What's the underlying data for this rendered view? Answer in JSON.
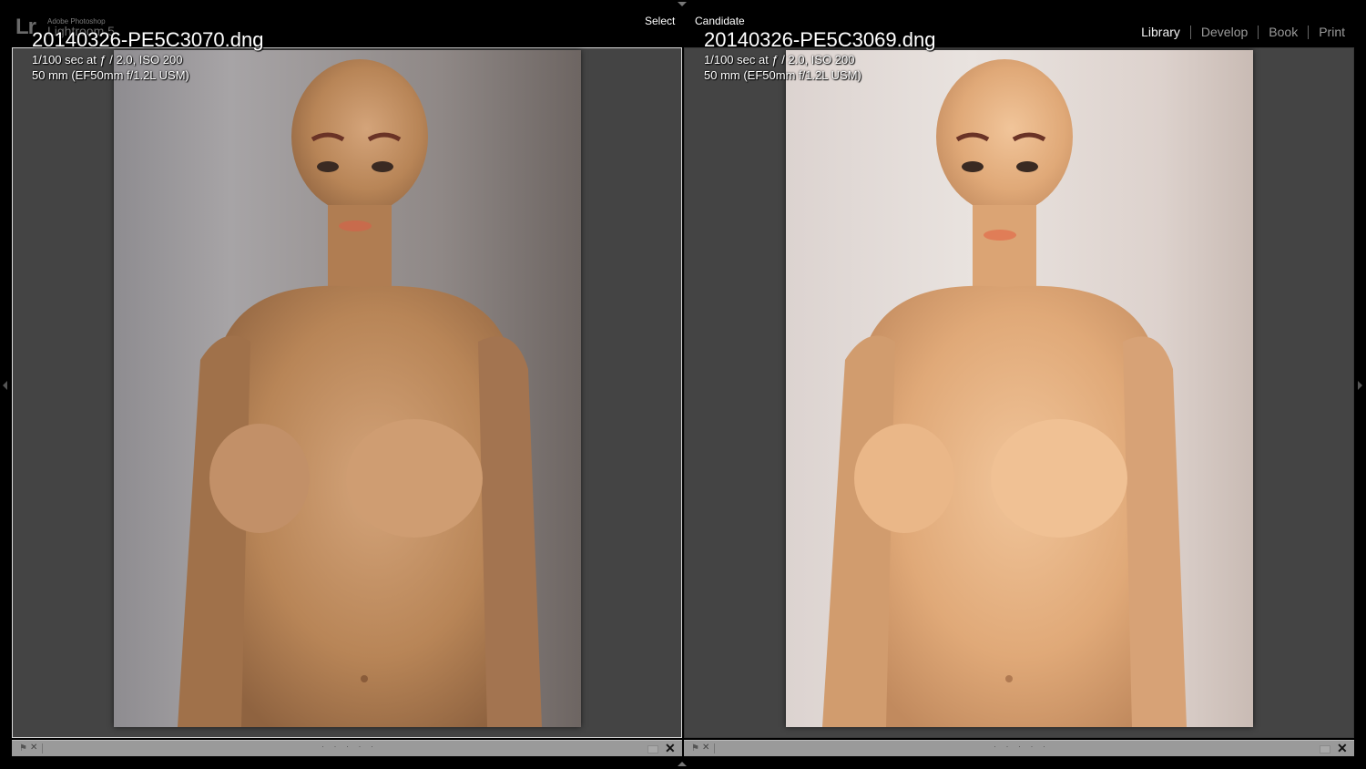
{
  "app": {
    "logo": "Lr",
    "brand": "Adobe Photoshop",
    "product": "Lightroom 5"
  },
  "compare": {
    "select_label": "Select",
    "candidate_label": "Candidate"
  },
  "modules": [
    "Library",
    "Develop",
    "Book",
    "Print"
  ],
  "active_module": "Library",
  "select_photo": {
    "filename": "20140326-PE5C3070.dng",
    "exposure": "1/100 sec at ƒ / 2.0, ISO 200",
    "lens": "50 mm (EF50mm f/1.2L USM)",
    "description": "mannequin photo, cooler grey background"
  },
  "candidate_photo": {
    "filename": "20140326-PE5C3069.dng",
    "exposure": "1/100 sec at ƒ / 2.0, ISO 200",
    "lens": "50 mm (EF50mm f/1.2L USM)",
    "description": "mannequin photo, warmer bright background"
  },
  "toolbar": {
    "flag_icon": "flag-icon",
    "reject_icon": "reject-icon",
    "dots": "· · · · ·",
    "close": "✕"
  },
  "colors": {
    "background": "#000000",
    "panel": "#444444",
    "toolbar": "#9a9a9a",
    "active_module": "#f2f2f2",
    "inactive_module": "#9a9a9a"
  }
}
